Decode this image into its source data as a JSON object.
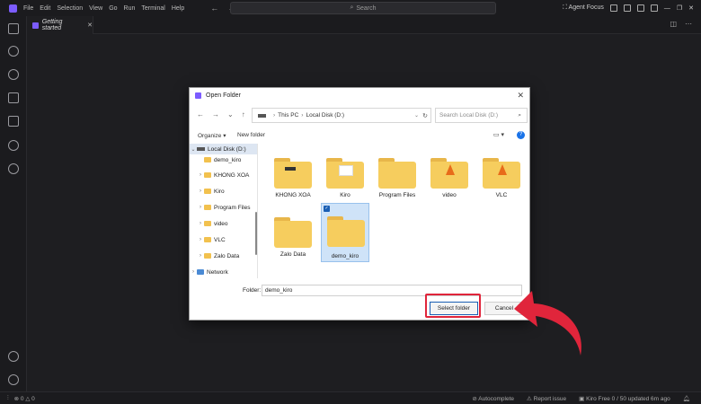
{
  "titlebar": {
    "menu": [
      "File",
      "Edit",
      "Selection",
      "View",
      "Go",
      "Run",
      "Terminal",
      "Help"
    ],
    "search_placeholder": "Search",
    "agent_focus": "Agent Focus"
  },
  "tabs": [
    {
      "label": "Getting started"
    }
  ],
  "dialog": {
    "title": "Open Folder",
    "path": [
      "This PC",
      "Local Disk (D:)"
    ],
    "search_placeholder": "Search Local Disk (D:)",
    "toolbar": {
      "organize": "Organize",
      "new_folder": "New folder"
    },
    "nav_items": [
      {
        "label": "Local Disk (D:)",
        "icon": "drive-icon",
        "expanded": true,
        "selected": true
      },
      {
        "label": "demo_kiro",
        "icon": "folder-icon"
      },
      {
        "label": "KHONG XOA",
        "icon": "folder-icon"
      },
      {
        "label": "Kiro",
        "icon": "folder-icon"
      },
      {
        "label": "Program Files",
        "icon": "folder-icon"
      },
      {
        "label": "video",
        "icon": "folder-icon"
      },
      {
        "label": "VLC",
        "icon": "folder-icon"
      },
      {
        "label": "Zalo Data",
        "icon": "folder-icon"
      },
      {
        "label": "Network",
        "icon": "network-icon"
      }
    ],
    "files": [
      {
        "name": "KHONG XOA",
        "overlay": "tab"
      },
      {
        "name": "Kiro",
        "overlay": "paper"
      },
      {
        "name": "Program Files",
        "overlay": "none"
      },
      {
        "name": "video",
        "overlay": "cone"
      },
      {
        "name": "VLC",
        "overlay": "cone"
      },
      {
        "name": "Zalo Data",
        "overlay": "none"
      },
      {
        "name": "demo_kiro",
        "overlay": "none",
        "selected": true
      }
    ],
    "folder_label": "Folder:",
    "folder_value": "demo_kiro",
    "select_button": "Select folder",
    "cancel_button": "Cancel"
  },
  "statusbar": {
    "errors": "0",
    "warnings": "0",
    "autocomplete": "Autocomplete",
    "report_issue": "Report issue",
    "plan": "Kiro Free 0 / 50 updated 6m ago"
  },
  "colors": {
    "accent": "#7c5cff",
    "highlight": "#e0253b",
    "folder": "#f6cd5e"
  }
}
